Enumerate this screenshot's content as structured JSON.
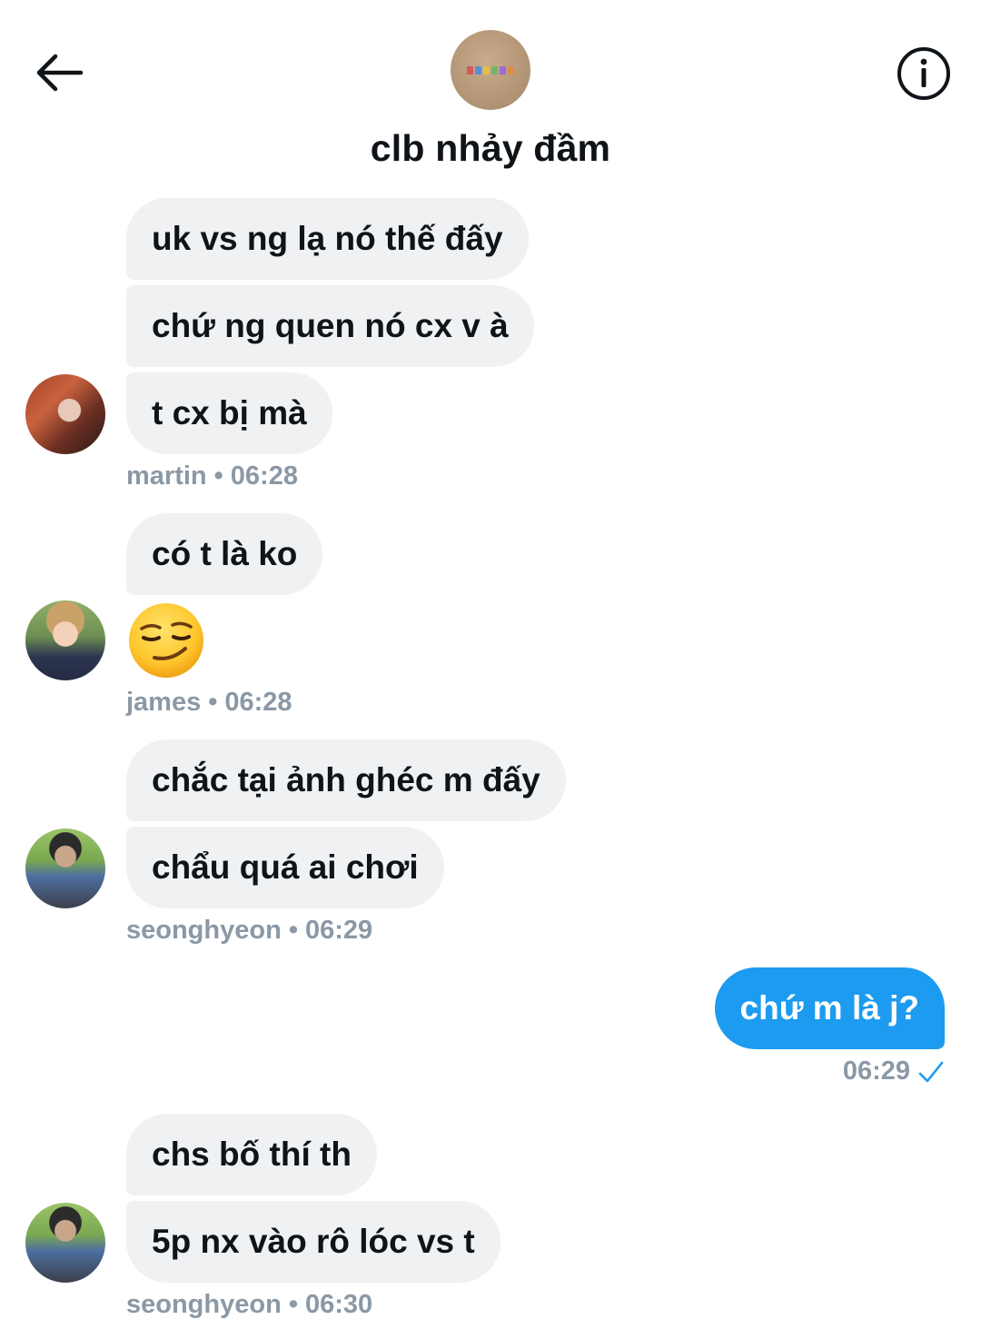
{
  "header": {
    "title": "clb nhảy đầm",
    "group_avatar_text": "CORTIS",
    "back_icon": "arrow-left-icon",
    "info_icon": "info-circle-icon"
  },
  "messages": [
    {
      "sender": "martin",
      "time": "06:28",
      "bubbles": [
        "uk vs ng lạ nó thế đấy",
        "chứ ng quen nó cx v à",
        "t cx bị mà"
      ]
    },
    {
      "sender": "james",
      "time": "06:28",
      "bubbles": [
        "có t là ko"
      ],
      "emoji": "smirking-face-emoji"
    },
    {
      "sender": "seonghyeon",
      "time": "06:29",
      "bubbles": [
        "chắc tại ảnh ghéc m đấy",
        "chẩu quá ai chơi"
      ]
    },
    {
      "mine": true,
      "time": "06:29",
      "bubbles": [
        "chứ m là j?"
      ],
      "status_icon": "sent-check-icon"
    },
    {
      "sender": "seonghyeon",
      "time": "06:30",
      "bubbles": [
        "chs bố thí th",
        "5p nx vào rô lóc vs t"
      ]
    }
  ],
  "meta_separator": "•",
  "colors": {
    "own_bubble": "#1d9bf0",
    "other_bubble": "#eff1f3",
    "meta_text": "#8b98a5",
    "check": "#1d9bf0"
  }
}
